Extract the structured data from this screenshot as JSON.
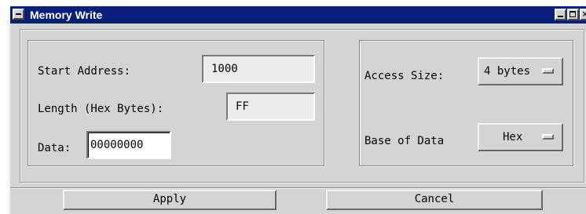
{
  "window": {
    "title": "Memory Write"
  },
  "fields": {
    "start_address": {
      "label": "Start Address:",
      "value": "1000"
    },
    "length": {
      "label": "Length (Hex Bytes):",
      "value": "FF"
    },
    "data": {
      "label": "Data:",
      "value": "00000000"
    }
  },
  "options": {
    "access_size": {
      "label": "Access Size:",
      "selected": "4 bytes"
    },
    "base_of_data": {
      "label": "Base of Data",
      "selected": "Hex"
    }
  },
  "buttons": {
    "apply": "Apply",
    "cancel": "Cancel"
  }
}
